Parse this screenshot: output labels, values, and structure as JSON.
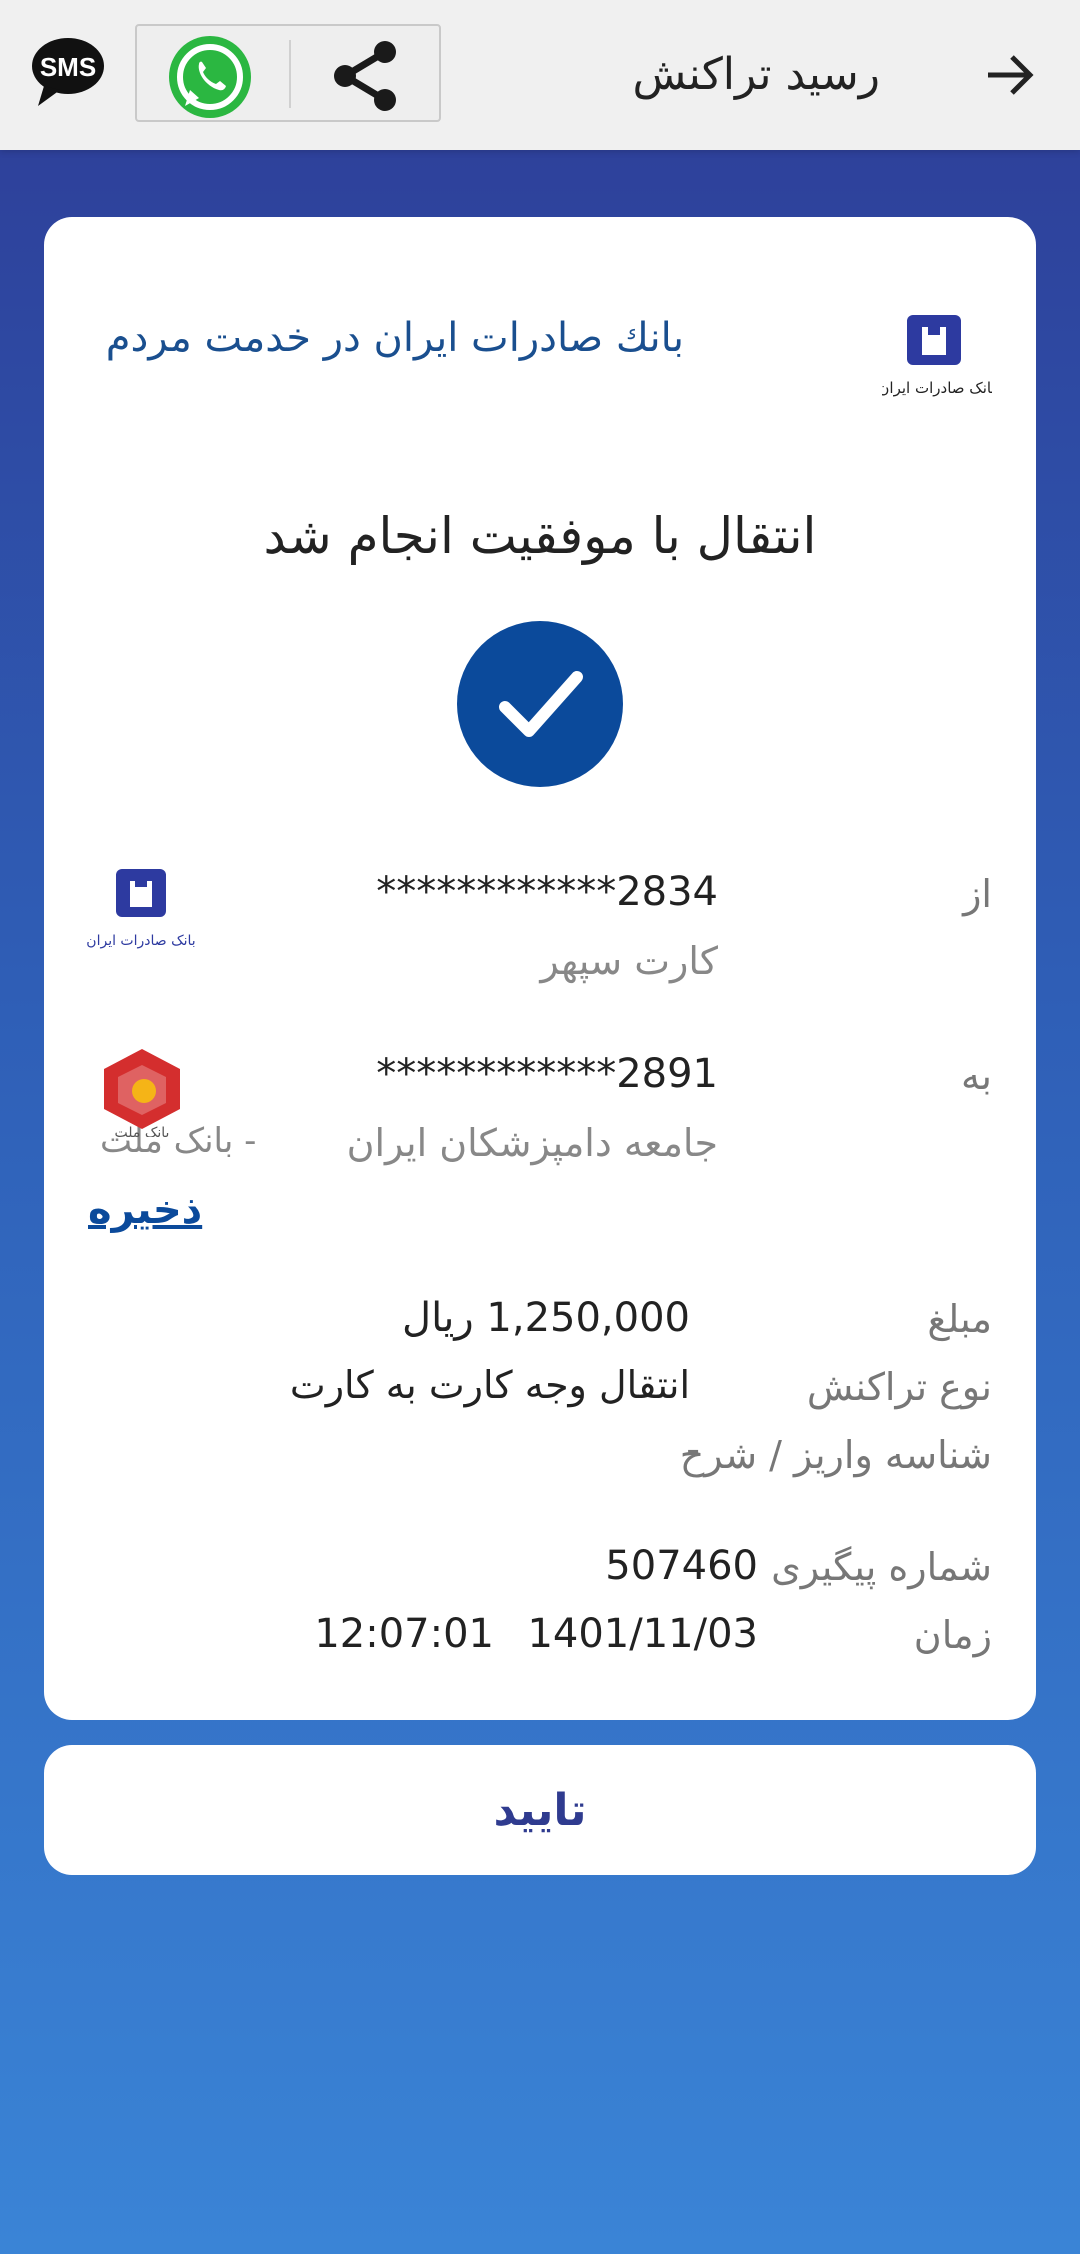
{
  "header": {
    "title": "رسید تراکنش",
    "back_icon": "arrow-right-icon",
    "share_icon": "share-icon",
    "whatsapp_icon": "whatsapp-icon",
    "sms_icon": "sms-icon",
    "sms_label": "SMS"
  },
  "receipt": {
    "bank_tagline": "بانك صادرات ایران در خدمت مردم",
    "bank_logo_text": "بانک صادرات ایران",
    "status_text": "انتقال با موفقیت انجام شد",
    "from": {
      "label": "از",
      "card_number": "************2834",
      "card_name": "کارت سپهر",
      "bank_logo_text": "بانک صادرات ایران"
    },
    "to": {
      "label": "به",
      "card_number": "************2891",
      "holder": "جامعه  دامپزشکان  ایران",
      "bank": "- بانک ملت",
      "bank_logo_text": "بانک ملت"
    },
    "save_label": "ذخیره",
    "amount_label": "مبلغ",
    "amount_value": "1,250,000 ریال",
    "type_label": "نوع تراکنش",
    "type_value": "انتقال وجه کارت به کارت",
    "payment_id_label": "شناسه واریز / شرح",
    "payment_id_value": "-",
    "tracking_label": "شماره پیگیری",
    "tracking_value": "507460",
    "time_label": "زمان",
    "date_value": "1401/11/03",
    "time_value": "12:07:01"
  },
  "confirm_label": "تایید",
  "colors": {
    "bank_blue": "#0b4a9b",
    "mellat_red": "#d42e2e",
    "background_top": "#2e3c96",
    "background_bottom": "#3a84d6"
  }
}
